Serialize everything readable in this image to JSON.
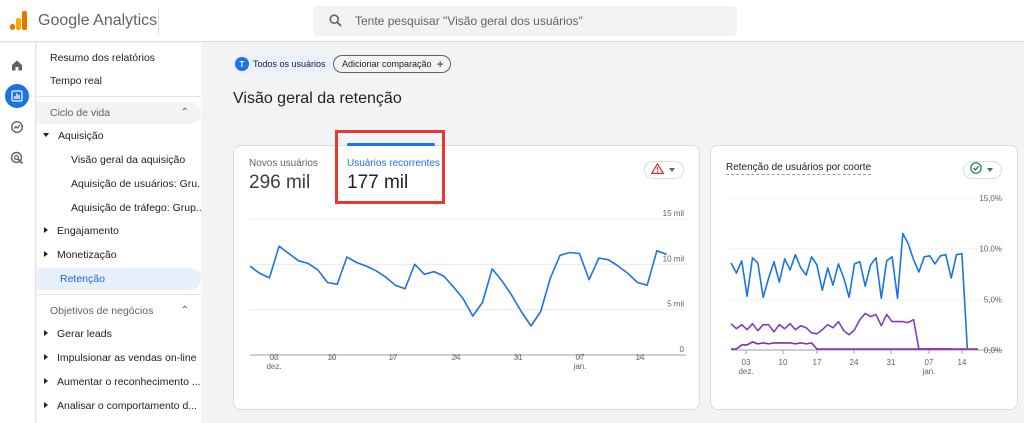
{
  "app": {
    "title": "Google Analytics"
  },
  "search": {
    "placeholder": "Tente pesquisar \"Visão geral dos usuários\""
  },
  "nav": {
    "items": [
      {
        "label": "Resumo dos relatórios",
        "level": 0
      },
      {
        "label": "Tempo real",
        "level": 0
      },
      {
        "label": "Ciclo de vida",
        "level": "section"
      },
      {
        "label": "Aquisição",
        "level": 1,
        "expanded": true
      },
      {
        "label": "Visão geral da aquisição",
        "level": 2
      },
      {
        "label": "Aquisição de usuários: Gru...",
        "level": 2
      },
      {
        "label": "Aquisição de tráfego: Grup...",
        "level": 2
      },
      {
        "label": "Engajamento",
        "level": 1
      },
      {
        "label": "Monetização",
        "level": 1
      },
      {
        "label": "Retenção",
        "level": 1,
        "active": true
      },
      {
        "label": "Objetivos de negócios",
        "level": "section2"
      },
      {
        "label": "Gerar leads",
        "level": 1
      },
      {
        "label": "Impulsionar as vendas on-line",
        "level": 1
      },
      {
        "label": "Aumentar o reconhecimento ...",
        "level": 1
      },
      {
        "label": "Analisar o comportamento d...",
        "level": 1
      }
    ]
  },
  "filters": {
    "avatar_letter": "T",
    "all_users": "Todos os usuários",
    "add_comparison": "Adicionar comparação"
  },
  "page": {
    "title": "Visão geral da retenção"
  },
  "metrics": {
    "new_users": {
      "label": "Novos usuários",
      "value": "296 mil"
    },
    "returning_users": {
      "label": "Usuários recorrentes",
      "value": "177 mil"
    }
  },
  "cohort": {
    "title": "Retenção de usuários por coorte"
  },
  "colors": {
    "accent": "#1a73e8",
    "series_line": "#1a73e8",
    "purple": "#7b3fbf",
    "magenta": "#8e24aa",
    "highlight": "#e53935"
  },
  "chart_data": [
    {
      "type": "line",
      "x": [
        "02 dez.",
        "03 dez.",
        "04 dez.",
        "05 dez.",
        "06 dez.",
        "07 dez.",
        "08 dez.",
        "09 dez.",
        "10 dez.",
        "11 dez.",
        "12 dez.",
        "13 dez.",
        "14 dez.",
        "15 dez.",
        "16 dez.",
        "17 dez.",
        "18 dez.",
        "19 dez.",
        "20 dez.",
        "21 dez.",
        "22 dez.",
        "23 dez.",
        "24 dez.",
        "25 dez.",
        "26 dez.",
        "27 dez.",
        "28 dez.",
        "29 dez.",
        "30 dez.",
        "31 dez.",
        "01 jan.",
        "02 jan.",
        "03 jan.",
        "04 jan.",
        "05 jan.",
        "06 jan.",
        "07 jan.",
        "08 jan.",
        "09 jan.",
        "10 jan.",
        "11 jan.",
        "12 jan.",
        "13 jan.",
        "14 jan.",
        "15 jan.",
        "16 jan."
      ],
      "xticks": [
        "03",
        "10",
        "17",
        "24",
        "31",
        "07",
        "14"
      ],
      "xtick_sub": {
        "03": "dez.",
        "07": "jan."
      },
      "yticks": [
        "0",
        "5 mil",
        "10 mil",
        "15 mil"
      ],
      "ylim": [
        0,
        15000
      ],
      "series": [
        {
          "values": [
            9800,
            9000,
            8500,
            12000,
            11200,
            10400,
            10100,
            9400,
            8000,
            7800,
            10800,
            10200,
            9800,
            9300,
            8600,
            7700,
            7300,
            10000,
            8900,
            9200,
            8700,
            7500,
            6200,
            4300,
            5800,
            9500,
            8200,
            6600,
            4800,
            3200,
            4800,
            8500,
            11000,
            11300,
            11200,
            8300,
            10700,
            10500,
            9800,
            9000,
            8000,
            7700,
            11500,
            11100
          ]
        }
      ]
    },
    {
      "type": "line",
      "x": [
        "01 dez.",
        "02 dez.",
        "03 dez.",
        "04 dez.",
        "05 dez.",
        "06 dez.",
        "07 dez.",
        "08 dez.",
        "09 dez.",
        "10 dez.",
        "11 dez.",
        "12 dez.",
        "13 dez.",
        "14 dez.",
        "15 dez.",
        "16 dez.",
        "17 dez.",
        "18 dez.",
        "19 dez.",
        "20 dez.",
        "21 dez.",
        "22 dez.",
        "23 dez.",
        "24 dez.",
        "25 dez.",
        "26 dez.",
        "27 dez.",
        "28 dez.",
        "29 dez.",
        "30 dez.",
        "31 dez.",
        "01 jan.",
        "02 jan.",
        "03 jan.",
        "04 jan.",
        "05 jan.",
        "06 jan.",
        "07 jan.",
        "08 jan.",
        "09 jan.",
        "10 jan.",
        "11 jan.",
        "12 jan.",
        "13 jan.",
        "14 jan.",
        "15 jan.",
        "16 jan."
      ],
      "xticks": [
        "03",
        "10",
        "17",
        "24",
        "31",
        "07",
        "14"
      ],
      "xtick_sub": {
        "03": "dez.",
        "07": "jan."
      },
      "yticks": [
        "0,0%",
        "5,0%",
        "10,0%",
        "15,0%"
      ],
      "ylim": [
        0,
        15
      ],
      "series": [
        {
          "values": [
            8.6,
            7.6,
            8.8,
            5.3,
            9.1,
            8.6,
            5.2,
            7.1,
            8.7,
            6.7,
            9.0,
            7.9,
            9.4,
            8.1,
            7.4,
            9.2,
            8.4,
            5.9,
            8.1,
            6.4,
            8.5,
            7.1,
            5.2,
            8.5,
            8.7,
            6.3,
            8.4,
            9.1,
            5.1,
            8.8,
            9.2,
            5.1,
            11.5,
            10.5,
            8.9,
            7.7,
            9.2,
            9.3,
            8.5,
            9.3,
            9.4,
            7.1,
            9.4,
            9.5,
            0.2
          ]
        },
        {
          "values": [
            2.6,
            2.1,
            2.5,
            2.0,
            2.6,
            1.9,
            2.5,
            2.5,
            1.8,
            2.5,
            2.1,
            2.6,
            2.0,
            2.4,
            2.2,
            1.7,
            1.6,
            2.0,
            2.5,
            2.2,
            2.8,
            1.9,
            1.5,
            2.0,
            3.0,
            3.6,
            3.3,
            3.5,
            2.4,
            3.5,
            2.8,
            2.8,
            2.8,
            2.7,
            3.0,
            0.1,
            0.1,
            0.1,
            0.1,
            0.1,
            0.1,
            0.1
          ]
        },
        {
          "values": [
            0.1,
            0.1,
            0.5,
            0.5,
            0.8,
            0.6,
            0.7,
            0.6,
            0.7,
            0.7,
            0.7,
            0.7,
            0.6,
            0.7,
            0.6,
            0.7,
            0.1,
            0.1,
            0.1,
            0.1,
            0.1,
            0.1,
            0.1,
            0.1,
            0.1,
            0.1,
            0.1,
            0.1,
            0.1,
            0.1,
            0.1,
            0.1,
            0.1,
            0.1,
            0.1,
            0.1,
            0.1,
            0.1,
            0.1,
            0.1,
            0.1,
            0.1,
            0.1,
            0.1,
            0.1,
            0.1,
            0.1
          ]
        }
      ]
    }
  ]
}
